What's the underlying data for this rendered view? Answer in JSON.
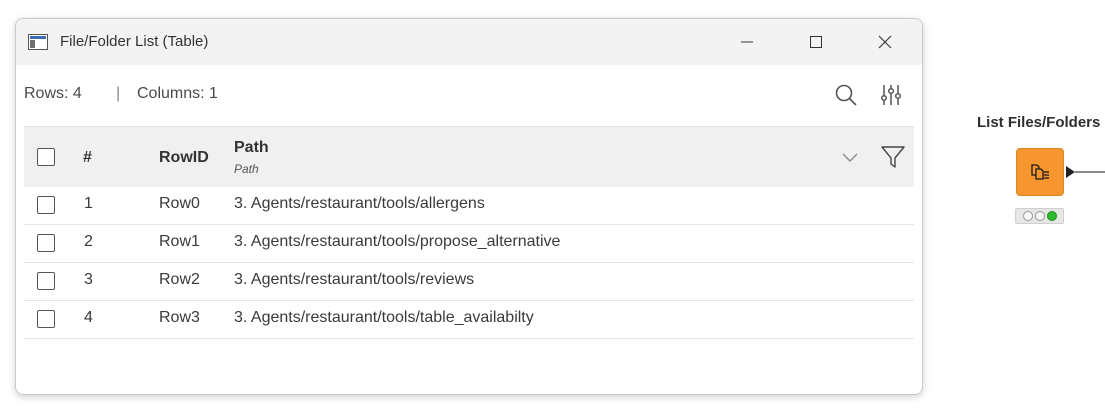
{
  "window": {
    "title": "File/Folder List (Table)",
    "icons": {
      "app": "table-view-icon",
      "minimize": "minimize-icon",
      "maximize": "maximize-icon",
      "close": "close-icon"
    }
  },
  "summary": {
    "rows_text": "Rows: 4",
    "separator": "|",
    "columns_text": "Columns: 1",
    "icons": {
      "search": "search-icon",
      "settings": "sliders-icon"
    }
  },
  "table": {
    "headers": {
      "num": "#",
      "rowid": "RowID",
      "path": "Path",
      "path_type": "Path"
    },
    "rows": [
      {
        "num": "1",
        "rowid": "Row0",
        "path": "3. Agents/restaurant/tools/allergens"
      },
      {
        "num": "2",
        "rowid": "Row1",
        "path": "3. Agents/restaurant/tools/propose_alternative"
      },
      {
        "num": "3",
        "rowid": "Row2",
        "path": "3. Agents/restaurant/tools/reviews"
      },
      {
        "num": "4",
        "rowid": "Row3",
        "path": "3. Agents/restaurant/tools/table_availabilty"
      }
    ]
  },
  "node": {
    "label": "List Files/Folders",
    "color": "#f7962f",
    "status": [
      "off",
      "off",
      "green"
    ]
  }
}
